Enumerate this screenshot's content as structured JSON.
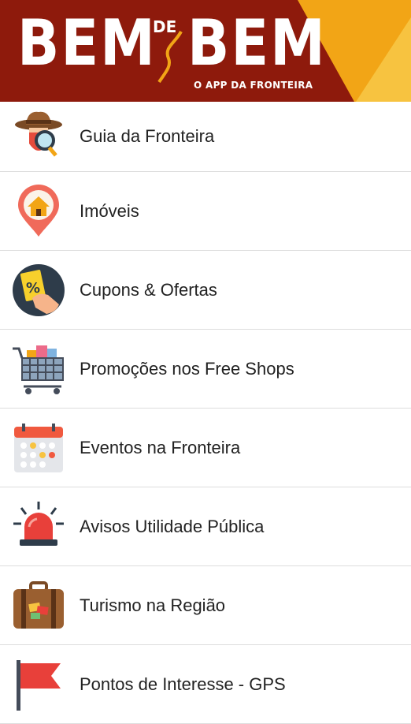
{
  "header": {
    "logo_left": "BEM",
    "logo_de": "DE",
    "logo_right": "BEM",
    "tagline": "O APP DA FRONTEIRA"
  },
  "menu": [
    {
      "label": "Guia da Fronteira",
      "icon": "detective-icon"
    },
    {
      "label": "Imóveis",
      "icon": "house-pin-icon"
    },
    {
      "label": "Cupons & Ofertas",
      "icon": "coupon-hand-icon"
    },
    {
      "label": "Promoções nos Free Shops",
      "icon": "shopping-cart-icon"
    },
    {
      "label": "Eventos na Fronteira",
      "icon": "calendar-icon"
    },
    {
      "label": "Avisos Utilidade Pública",
      "icon": "siren-icon"
    },
    {
      "label": "Turismo na Região",
      "icon": "suitcase-icon"
    },
    {
      "label": "Pontos de Interesse - GPS",
      "icon": "flag-icon"
    }
  ],
  "colors": {
    "header_bg": "#8e1a0c",
    "header_accent": "#f2a516",
    "divider": "#dddddd"
  }
}
